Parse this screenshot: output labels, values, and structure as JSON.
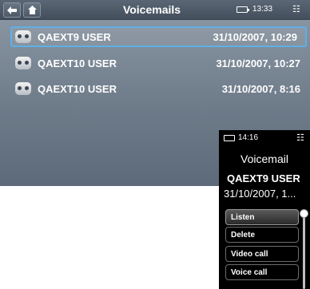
{
  "main": {
    "title": "Voicemails",
    "clock": "13:33",
    "rows": [
      {
        "name": "QAEXT9 USER",
        "date": "31/10/2007, 10:29"
      },
      {
        "name": "QAEXT10 USER",
        "date": "31/10/2007, 10:27"
      },
      {
        "name": "QAEXT10 USER",
        "date": "31/10/2007, 8:16"
      }
    ]
  },
  "portrait": {
    "clock": "14:16",
    "title": "Voicemail",
    "name": "QAEXT9 USER",
    "date": "31/10/2007, 1...",
    "buttons": [
      "Listen",
      "Delete",
      "Video call",
      "Voice call"
    ]
  },
  "colors": {
    "selection_border": "#5fb0e6",
    "background_top": "#8e9aa6",
    "background_bottom": "#5d6a79"
  },
  "icons": [
    "back-arrow-icon",
    "home-icon",
    "battery-icon",
    "network-icon",
    "voicemail-icon"
  ]
}
